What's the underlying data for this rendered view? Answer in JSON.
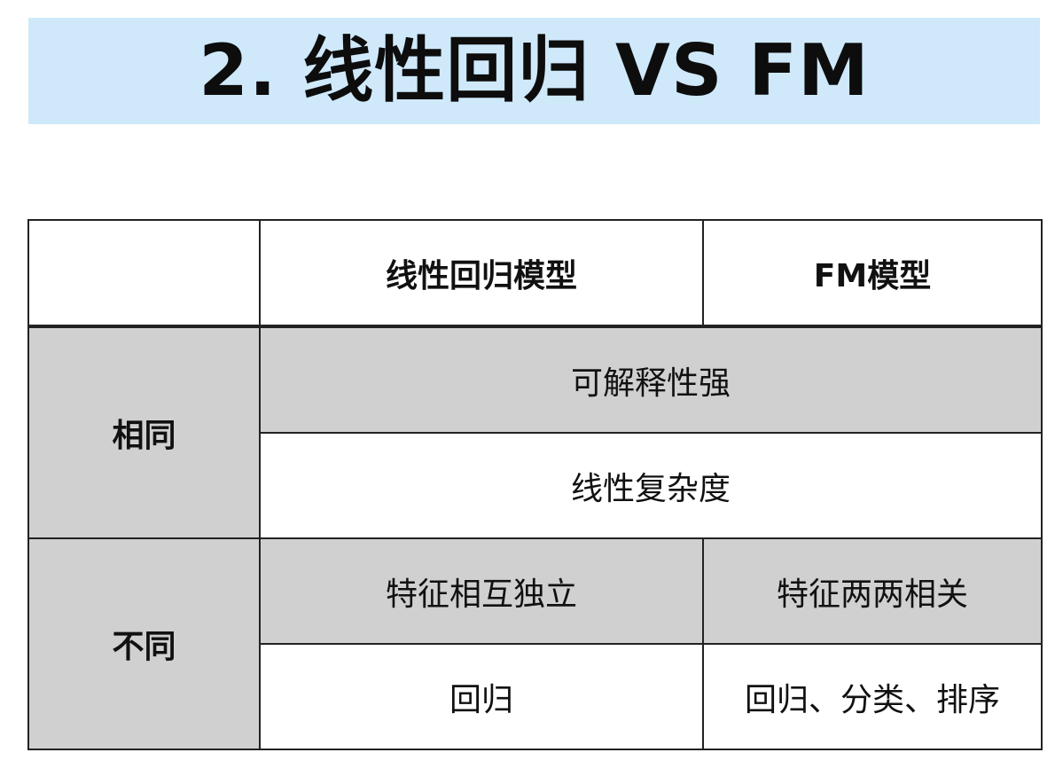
{
  "title": "2. 线性回归 VS FM",
  "table": {
    "header": {
      "corner": "",
      "col1": "线性回归模型",
      "col2": "FM模型"
    },
    "same": {
      "label": "相同",
      "row1": "可解释性强",
      "row2": "线性复杂度"
    },
    "different": {
      "label": "不同",
      "row1": {
        "col1": "特征相互独立",
        "col2": "特征两两相关"
      },
      "row2": {
        "col1": "回归",
        "col2": "回归、分类、排序"
      }
    }
  },
  "colors": {
    "title_banner": "#cfe9fb",
    "grey_cell": "#d0d0d0",
    "border": "#222222"
  }
}
